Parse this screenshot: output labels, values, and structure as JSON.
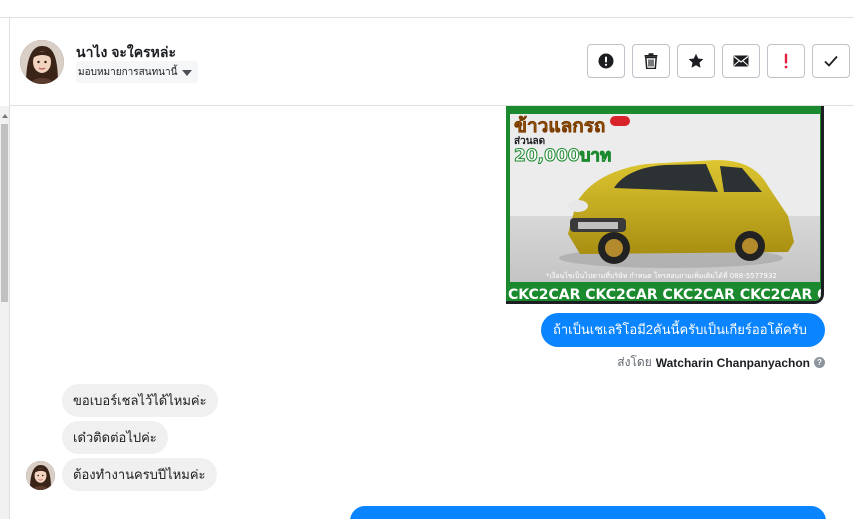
{
  "contact": {
    "name": "นาไง จะใครหล่ะ",
    "assign_label": "มอบหมายการสนทนานี้"
  },
  "toolbar": {
    "buttons": [
      {
        "name": "spam-button",
        "icon": "exclamation-circle-icon"
      },
      {
        "name": "delete-button",
        "icon": "trash-icon"
      },
      {
        "name": "star-button",
        "icon": "star-icon"
      },
      {
        "name": "mark-unread-button",
        "icon": "envelope-icon"
      },
      {
        "name": "follow-up-button",
        "icon": "exclamation-icon"
      },
      {
        "name": "mark-done-button",
        "icon": "check-icon"
      }
    ]
  },
  "image_message": {
    "headline": "ข้าวแลกรถ",
    "discount_label": "ส่วนลด",
    "discount_amount": "20,000บาท",
    "caption_line": "*เงื่อนไขเป็นไปตามที่บริษัท กำหนด โทรสอบถามเพิ่มเติมได้ที่ 088-5577932",
    "banner": "CKC2CAR CKC2CAR CKC2CAR CKC2CAR CKC2CAR CKC2"
  },
  "messages": {
    "outgoing_1": "ถ้าเป็นเชเลริโอมี2คันนี้ครับเป็นเกียร์ออโต้ครับ",
    "sent_by_label": "ส่งโดย",
    "sender_name": "Watcharin Chanpanyachon",
    "help_glyph": "?",
    "incoming": [
      "ขอเบอร์เชลไว้ได้ไหมค่ะ",
      "เด๋วติดต่อไปค่ะ",
      "ต้องทำงานครบปีไหมค่ะ"
    ]
  },
  "colors": {
    "outgoing_bubble": "#0b84ff",
    "incoming_bubble": "#f1f0f0",
    "banner_green": "#1b8a2e",
    "car_yellow": "#c9b21c"
  }
}
